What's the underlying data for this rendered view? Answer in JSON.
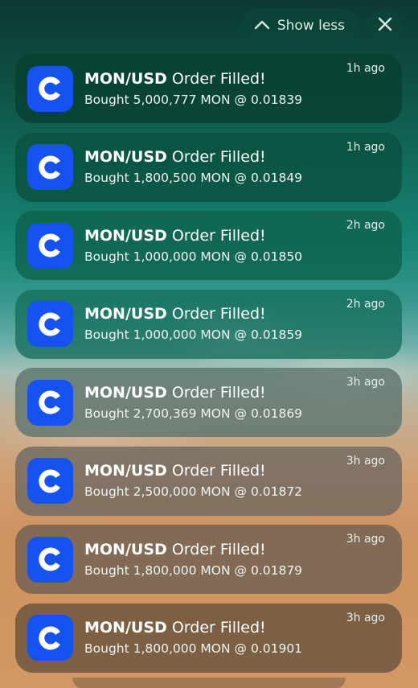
{
  "header": {
    "show_less_label": "Show less",
    "show_less_icon": "chevron-up-icon",
    "close_icon": "close-icon"
  },
  "app": {
    "icon": "coinbase-logo-icon",
    "brand_color": "#1652f0"
  },
  "notifications": [
    {
      "pair": "MON/USD",
      "status": "Order Filled!",
      "body": "Bought 5,000,777 MON @ 0.01839",
      "time": "1h ago"
    },
    {
      "pair": "MON/USD",
      "status": "Order Filled!",
      "body": "Bought 1,800,500 MON @ 0.01849",
      "time": "1h ago"
    },
    {
      "pair": "MON/USD",
      "status": "Order Filled!",
      "body": "Bought 1,000,000 MON @ 0.01850",
      "time": "2h ago"
    },
    {
      "pair": "MON/USD",
      "status": "Order Filled!",
      "body": "Bought 1,000,000 MON @ 0.01859",
      "time": "2h ago"
    },
    {
      "pair": "MON/USD",
      "status": "Order Filled!",
      "body": "Bought 2,700,369 MON @ 0.01869",
      "time": "3h ago"
    },
    {
      "pair": "MON/USD",
      "status": "Order Filled!",
      "body": "Bought 2,500,000 MON @ 0.01872",
      "time": "3h ago"
    },
    {
      "pair": "MON/USD",
      "status": "Order Filled!",
      "body": "Bought 1,800,000 MON @ 0.01879",
      "time": "3h ago"
    },
    {
      "pair": "MON/USD",
      "status": "Order Filled!",
      "body": "Bought 1,800,000 MON @ 0.01901",
      "time": "3h ago"
    }
  ]
}
